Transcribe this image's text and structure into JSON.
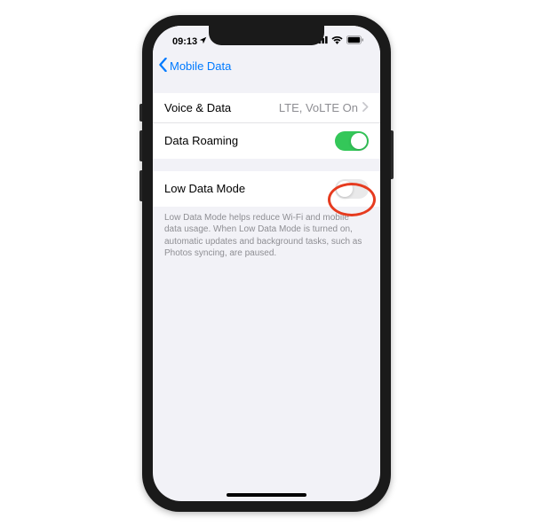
{
  "status": {
    "time": "09:13",
    "signal_icon": "signal-icon",
    "wifi_icon": "wifi-icon",
    "battery_icon": "battery-icon"
  },
  "nav": {
    "back_label": "Mobile Data"
  },
  "group1": {
    "voice_data_label": "Voice & Data",
    "voice_data_value": "LTE, VoLTE On",
    "data_roaming_label": "Data Roaming",
    "data_roaming_on": true
  },
  "group2": {
    "low_data_label": "Low Data Mode",
    "low_data_on": false
  },
  "footer": {
    "text": "Low Data Mode helps reduce Wi-Fi and mobile data usage. When Low Data Mode is turned on, automatic updates and background tasks, such as Photos syncing, are paused."
  }
}
